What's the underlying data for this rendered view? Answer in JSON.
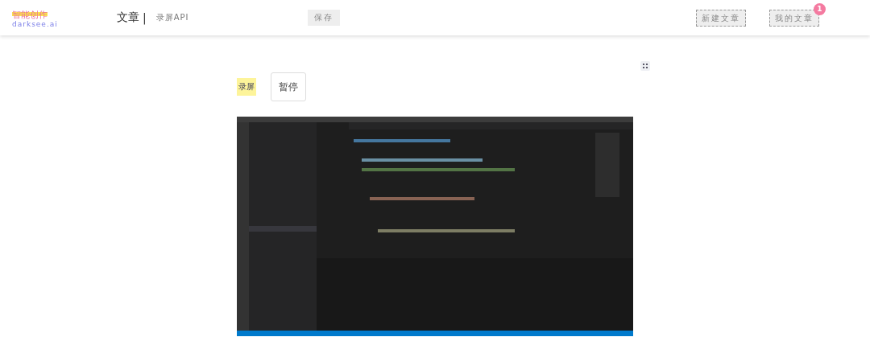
{
  "logo": {
    "title": "智能创作",
    "subtitle": "darksee.ai"
  },
  "nav": [
    {
      "label": "文章",
      "selected": true
    },
    {
      "label": "录屏API",
      "selected": false
    }
  ],
  "nav_separator": "|",
  "save_button": "保存",
  "actions": [
    {
      "label": "新建文章"
    },
    {
      "label": "我的文章",
      "badge": "1"
    }
  ],
  "editor": {
    "record_label": "录屏",
    "pause_button": "暂停"
  }
}
